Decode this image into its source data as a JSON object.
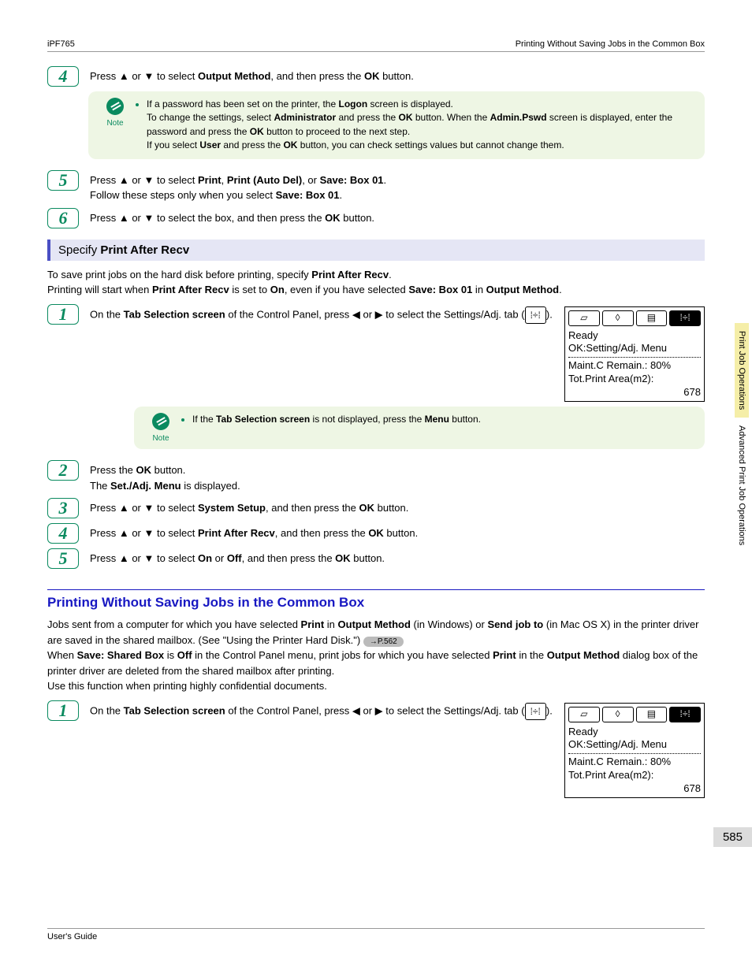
{
  "header": {
    "left": "iPF765",
    "right": "Printing Without Saving Jobs in the Common Box"
  },
  "steps_a": {
    "s4": {
      "num": "4",
      "pre": "Press ▲ or ▼ to select ",
      "bold1": "Output Method",
      "post1": ", and then press the ",
      "bold2": "OK",
      "post2": " button."
    },
    "s5": {
      "num": "5",
      "pre": "Press ▲ or ▼ to select ",
      "b1": "Print",
      "c1": ", ",
      "b2": "Print (Auto Del)",
      "c2": ", or ",
      "b3": "Save: Box 01",
      "post": ".",
      "line2a": "Follow these steps only when you select ",
      "line2b": "Save: Box 01",
      "line2c": "."
    },
    "s6": {
      "num": "6",
      "pre": "Press ▲ or ▼ to select the box, and then press the ",
      "bold": "OK",
      "post": " button."
    }
  },
  "note1": {
    "label": "Note",
    "l1a": "If a password has been set on the printer, the ",
    "l1b": "Logon",
    "l1c": " screen is displayed.",
    "l2a": "To change the settings, select ",
    "l2b": "Administrator",
    "l2c": " and press the ",
    "l2d": "OK",
    "l2e": " button. When the ",
    "l2f": "Admin.Pswd",
    "l2g": " screen is displayed, enter the password and press the ",
    "l2h": "OK",
    "l2i": " button to proceed to the next step.",
    "l3a": "If you select ",
    "l3b": "User",
    "l3c": " and press the ",
    "l3d": "OK",
    "l3e": " button, you can check settings values but cannot change them."
  },
  "section_bar": {
    "pre": "Specify ",
    "bold": "Print After Recv"
  },
  "intro_b": {
    "l1a": "To save print jobs on the hard disk before printing, specify ",
    "l1b": "Print After Recv",
    "l1c": ".",
    "l2a": "Printing will start when ",
    "l2b": "Print After Recv",
    "l2c": " is set to ",
    "l2d": "On",
    "l2e": ", even if you have selected ",
    "l2f": "Save: Box 01",
    "l2g": " in ",
    "l2h": "Output Method",
    "l2i": "."
  },
  "steps_b": {
    "s1": {
      "num": "1",
      "pre": "On the ",
      "b1": "Tab Selection screen",
      "post1": " of the Control Panel, press ◀ or ▶ to select the Settings/Adj. tab (",
      "icon": "⁞÷⁞",
      "post2": ")."
    },
    "s2": {
      "num": "2",
      "l1a": "Press the ",
      "l1b": "OK",
      "l1c": " button.",
      "l2a": "The ",
      "l2b": "Set./Adj. Menu",
      "l2c": " is displayed."
    },
    "s3": {
      "num": "3",
      "pre": "Press ▲ or ▼ to select ",
      "b": "System Setup",
      "post1": ", and then press the ",
      "b2": "OK",
      "post2": " button."
    },
    "s4": {
      "num": "4",
      "pre": "Press ▲ or ▼ to select ",
      "b": "Print After Recv",
      "post1": ", and then press the ",
      "b2": "OK",
      "post2": " button."
    },
    "s5": {
      "num": "5",
      "pre": "Press ▲ or ▼ to select ",
      "b": "On",
      "mid": " or ",
      "b2": "Off",
      "post1": ", and then press the ",
      "b3": "OK",
      "post2": " button."
    }
  },
  "note2": {
    "label": "Note",
    "pre": "If the ",
    "b1": "Tab Selection screen",
    "mid": " is not displayed, press the ",
    "b2": "Menu",
    "post": " button."
  },
  "section_title": "Printing Without Saving Jobs in the Common Box",
  "para_c": {
    "l1a": "Jobs sent from a computer for which you have selected ",
    "l1b": "Print",
    "l1c": " in ",
    "l1d": "Output Method",
    "l1e": " (in Windows) or ",
    "l1f": "Send job to",
    "l1g": " (in Mac OS X) in the printer driver are saved in the shared mailbox.  (See \"Using the Printer Hard Disk.\") ",
    "ref": "→P.562",
    "l2a": "When ",
    "l2b": "Save: Shared Box",
    "l2c": " is ",
    "l2d": "Off",
    "l2e": " in the Control Panel menu, print jobs for which you have selected ",
    "l2f": "Print",
    "l2g": " in the ",
    "l2h": "Output Method",
    "l2i": " dialog box of the printer driver are deleted from the shared mailbox after printing.",
    "l3": "Use this function when printing highly confidential documents."
  },
  "steps_c": {
    "s1": {
      "num": "1",
      "pre": "On the ",
      "b1": "Tab Selection screen",
      "post1": " of the Control Panel, press ◀ or ▶ to select the Settings/Adj. tab (",
      "icon": "⁞÷⁞",
      "post2": ")."
    }
  },
  "lcd": {
    "ready": "Ready",
    "ok": "OK:Setting/Adj. Menu",
    "maint": "Maint.C Remain.: 80%",
    "area": "Tot.Print Area(m2):",
    "num": "678"
  },
  "side": {
    "tab1": "Print Job Operations",
    "tab2": "Advanced Print Job Operations"
  },
  "page_num": "585",
  "footer": "User's Guide"
}
